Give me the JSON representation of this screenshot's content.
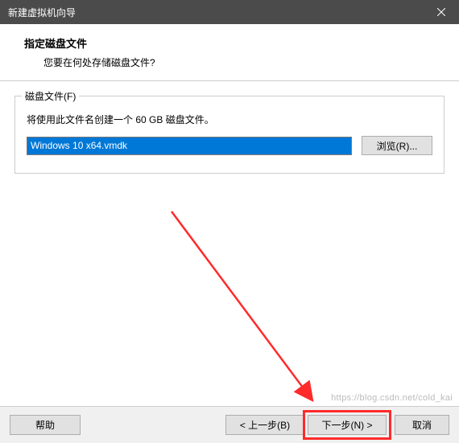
{
  "titlebar": {
    "title": "新建虚拟机向导"
  },
  "header": {
    "title": "指定磁盘文件",
    "subtitle": "您要在何处存储磁盘文件?"
  },
  "fieldset": {
    "legend": "磁盘文件(F)",
    "description": "将使用此文件名创建一个 60 GB 磁盘文件。",
    "input_value": "Windows 10 x64.vmdk",
    "browse_label": "浏览(R)..."
  },
  "footer": {
    "help": "帮助",
    "back": "< 上一步(B)",
    "next": "下一步(N) >",
    "cancel": "取消"
  },
  "watermark": "https://blog.csdn.net/cold_kai"
}
